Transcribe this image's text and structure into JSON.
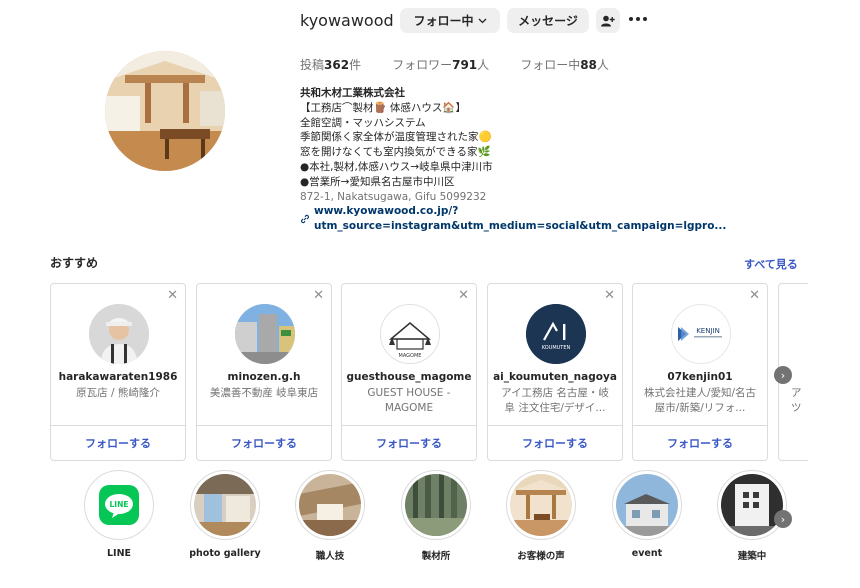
{
  "profile": {
    "username": "kyowawood",
    "follow_button": "フォロー中",
    "message_button": "メッセージ",
    "posts_label_prefix": "投稿",
    "posts_count": "362",
    "posts_label_suffix": "件",
    "followers_label_prefix": "フォロワー",
    "followers_count": "791",
    "followers_label_suffix": "人",
    "following_label_prefix": "フォロー中",
    "following_count": "88",
    "following_label_suffix": "人"
  },
  "bio": {
    "name": "共和木材工業株式会社",
    "lines": [
      "【工務店⌒製材🪵 体感ハウス🏠】",
      "全館空調・マッハシステム",
      "季節関係く家全体が温度管理された家🟡",
      "窓を開けなくても室内換気ができる家🌿",
      "●本社,製材,体感ハウス→岐阜県中津川市",
      "●営業所→愛知県名古屋市中川区"
    ],
    "address": "872-1, Nakatsugawa, Gifu 5099232",
    "link": "www.kyowawood.co.jp/?utm_source=instagram&utm_medium=social&utm_campaign=lgpro..."
  },
  "recommendations": {
    "title": "おすすめ",
    "see_all": "すべて見る",
    "follow_label": "フォローする",
    "cards": [
      {
        "username": "harakawaraten1986",
        "desc": "原瓦店 / 熊崎隆介"
      },
      {
        "username": "minozen.g.h",
        "desc": "美濃善不動産 岐阜東店"
      },
      {
        "username": "guesthouse_magome",
        "desc": "GUEST HOUSE - MAGOME FURUSATO..."
      },
      {
        "username": "ai_koumuten_nagoya",
        "desc": "アイ工務店 名古屋・岐阜 注文住宅/デザイ..."
      },
      {
        "username": "07kenjin01",
        "desc": "株式会社建人/愛知/名古屋市/新築/リフォ..."
      }
    ],
    "partial_text": "ア\nツ",
    "logos": {
      "ai_text": "KOUMUTEN",
      "kenjin_text": "KENJIN",
      "magome_text": "MAGOME"
    }
  },
  "highlights": [
    {
      "label": "LINE",
      "icon_text": "LINE"
    },
    {
      "label": "photo gallery"
    },
    {
      "label": "職人技"
    },
    {
      "label": "製材所"
    },
    {
      "label": "お客様の声"
    },
    {
      "label": "event"
    },
    {
      "label": "建築中"
    }
  ],
  "colors": {
    "link_blue": "#3a58c6",
    "button_gray": "#efefef",
    "line_green": "#06c755",
    "ai_navy": "#1b3553"
  }
}
